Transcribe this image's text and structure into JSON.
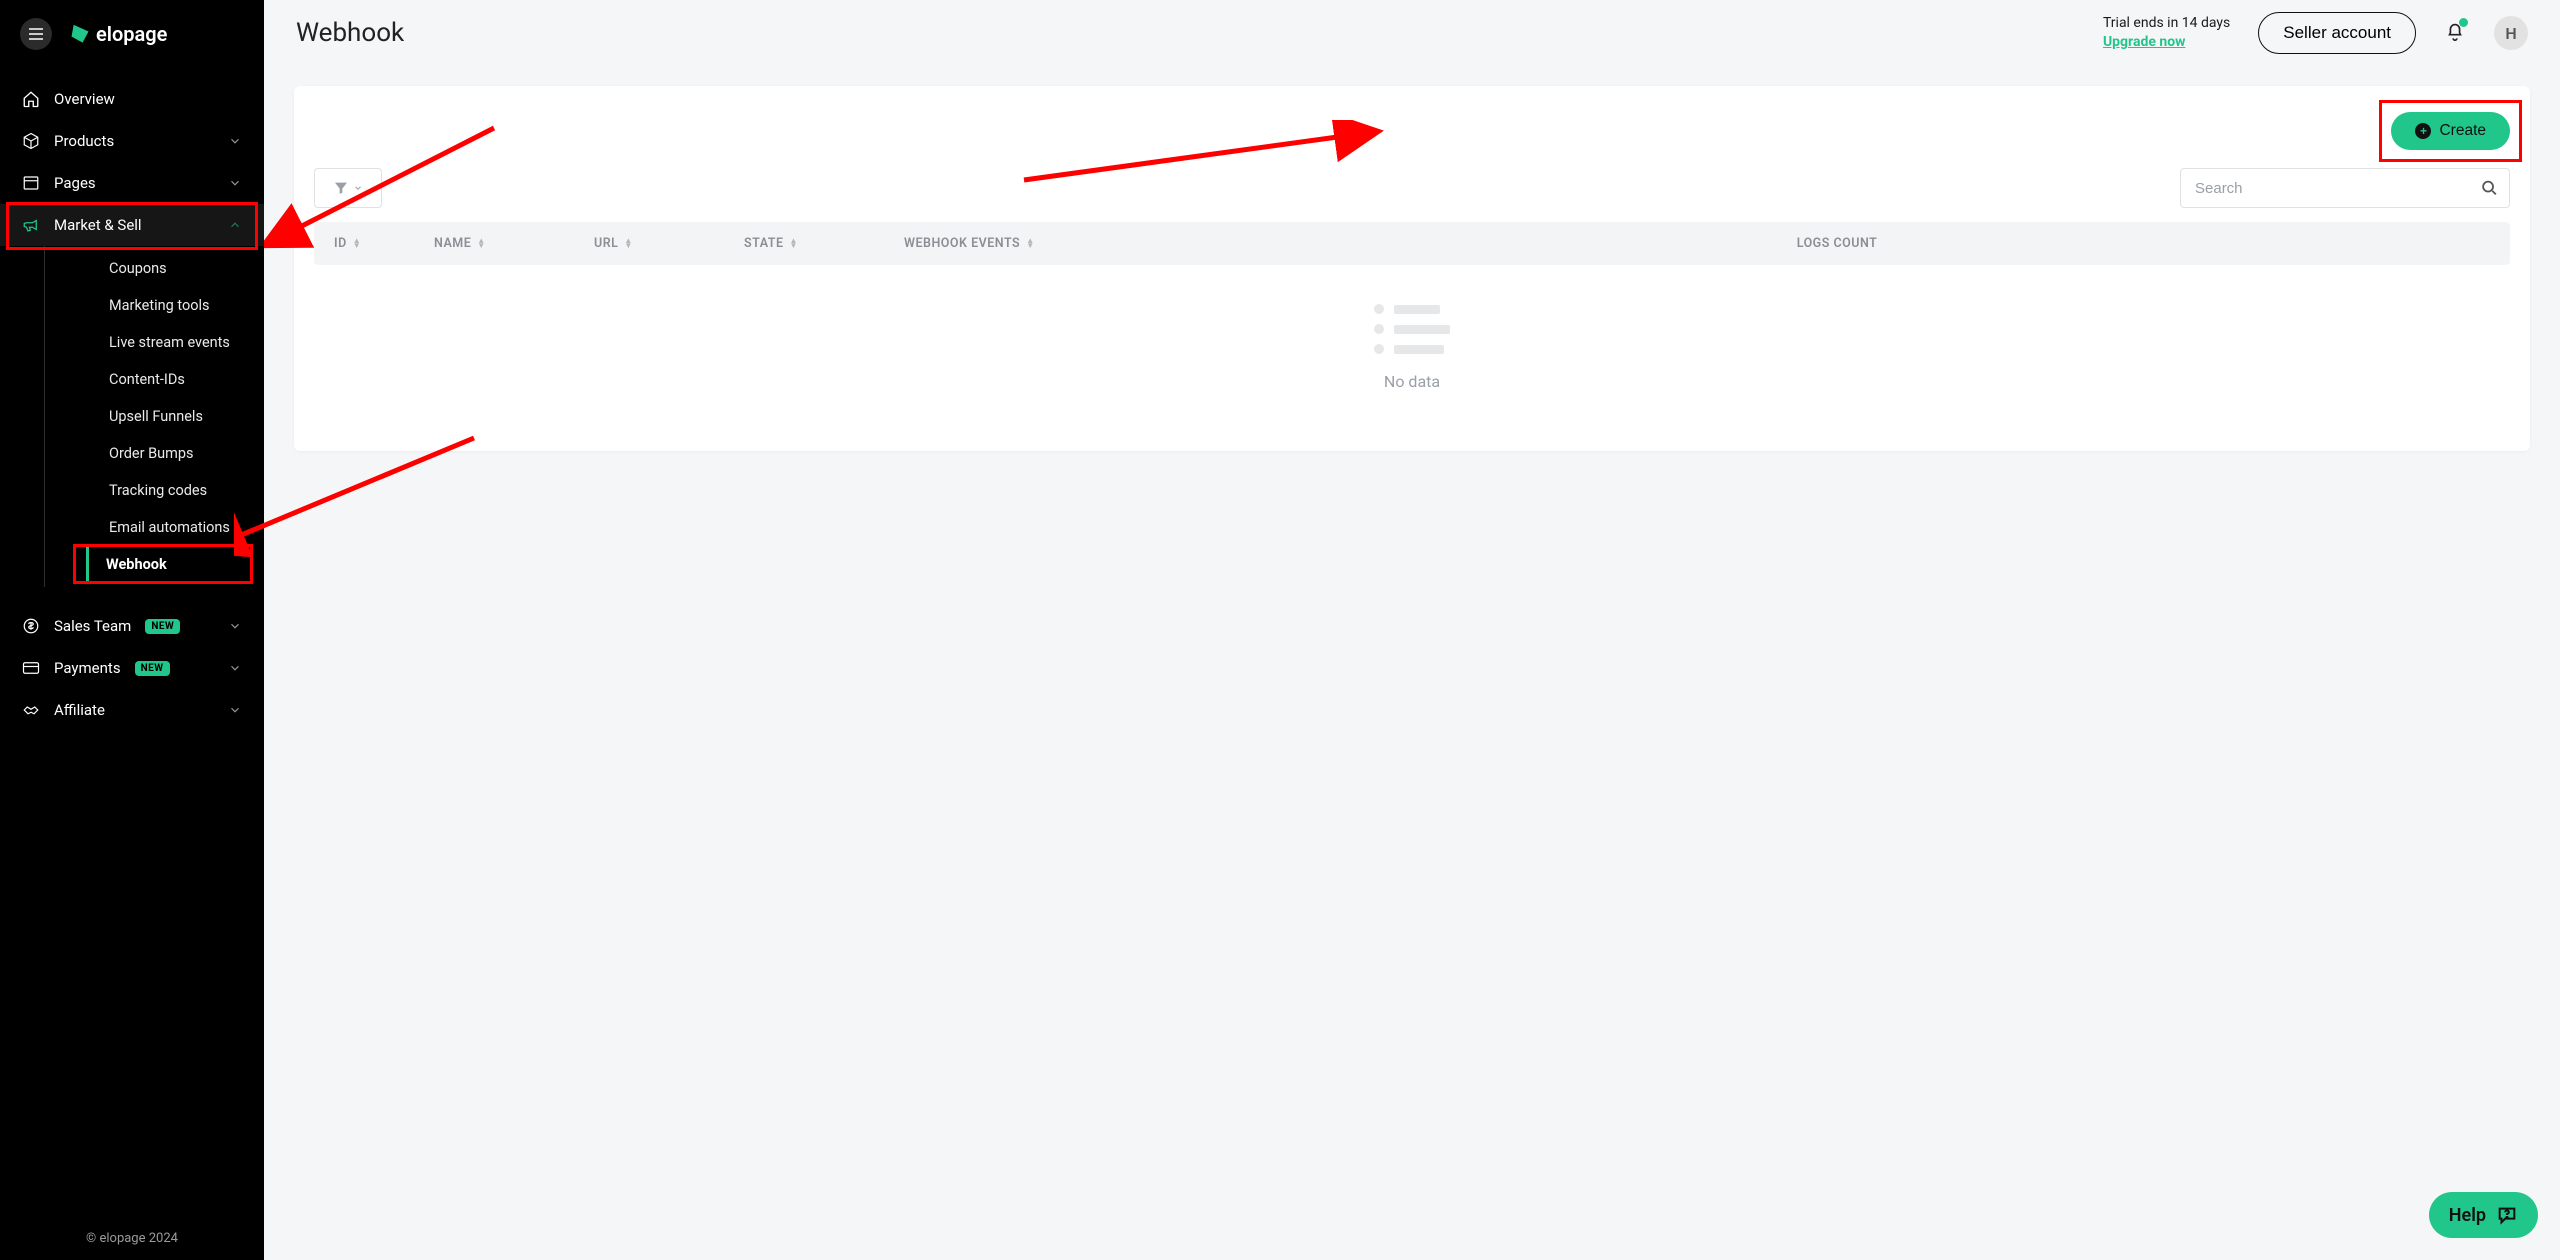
{
  "brand": "elopage",
  "footer": "© elopage 2024",
  "page_title": "Webhook",
  "trial": {
    "text": "Trial ends in 14 days",
    "upgrade_label": "Upgrade now"
  },
  "topbar": {
    "seller_account": "Seller account",
    "avatar_initial": "H"
  },
  "create_label": "Create",
  "search_placeholder": "Search",
  "table": {
    "id": "ID",
    "name": "NAME",
    "url": "URL",
    "state": "STATE",
    "events": "WEBHOOK EVENTS",
    "logs": "LOGS COUNT",
    "no_data": "No data"
  },
  "nav": {
    "overview": "Overview",
    "products": "Products",
    "pages": "Pages",
    "market_sell": "Market & Sell",
    "sales_team": "Sales Team",
    "payments": "Payments",
    "affiliate": "Affiliate",
    "new_badge": "NEW"
  },
  "sub": {
    "coupons": "Coupons",
    "marketing_tools": "Marketing tools",
    "live_stream": "Live stream events",
    "content_ids": "Content-IDs",
    "upsell": "Upsell Funnels",
    "order_bumps": "Order Bumps",
    "tracking": "Tracking codes",
    "email_auto": "Email automations",
    "webhook": "Webhook"
  },
  "help_label": "Help"
}
